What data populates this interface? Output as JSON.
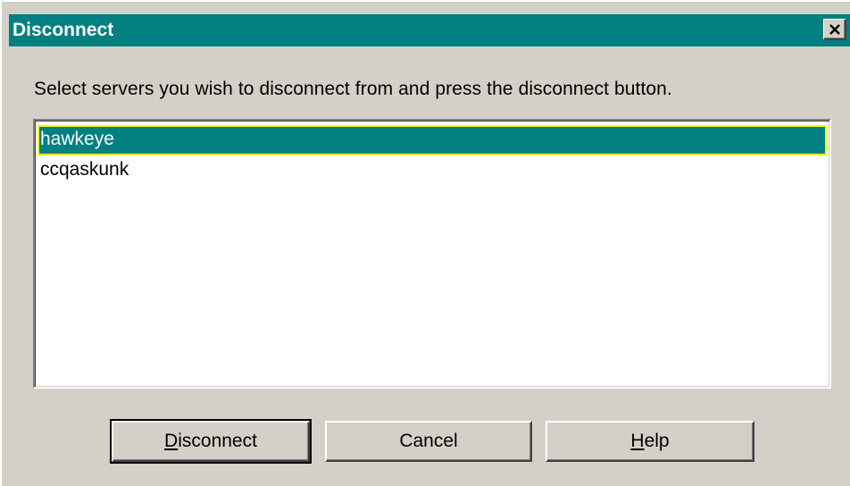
{
  "window": {
    "title": "Disconnect",
    "close_label": "×"
  },
  "instructions": "Select servers you wish to disconnect from and press the disconnect button.",
  "servers": [
    {
      "name": "hawkeye",
      "selected": true
    },
    {
      "name": "ccqaskunk",
      "selected": false
    }
  ],
  "buttons": {
    "disconnect": {
      "mnemonic": "D",
      "rest": "isconnect"
    },
    "cancel": {
      "label": "Cancel"
    },
    "help": {
      "mnemonic": "H",
      "rest": "elp"
    }
  },
  "colors": {
    "titlebar": "#008080",
    "dialog_bg": "#d4d0c8",
    "selection_bg": "#008080",
    "selection_focus": "#ffff00"
  }
}
